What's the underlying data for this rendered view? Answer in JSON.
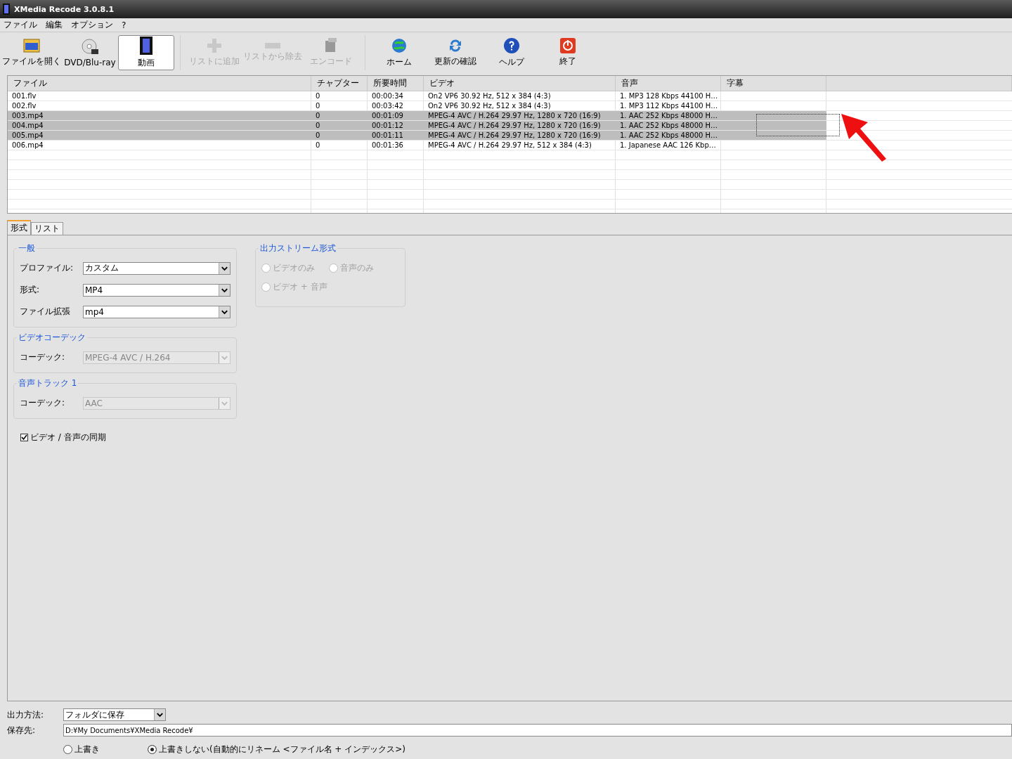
{
  "window": {
    "title": "XMedia Recode 3.0.8.1"
  },
  "menu": [
    "ファイル",
    "編集",
    "オプション",
    "?"
  ],
  "toolbar": {
    "groups": [
      [
        {
          "label": "ファイルを開く",
          "selected": false,
          "disabled": false
        },
        {
          "label": "DVD/Blu-ray",
          "selected": false,
          "disabled": false
        },
        {
          "label": "動画",
          "selected": true,
          "disabled": false
        }
      ],
      [
        {
          "label": "リストに追加",
          "selected": false,
          "disabled": true
        },
        {
          "label": "リストから除去",
          "selected": false,
          "disabled": true
        },
        {
          "label": "エンコード",
          "selected": false,
          "disabled": true
        }
      ],
      [
        {
          "label": "ホーム",
          "selected": false,
          "disabled": false
        },
        {
          "label": "更新の確認",
          "selected": false,
          "disabled": false
        },
        {
          "label": "ヘルプ",
          "selected": false,
          "disabled": false
        },
        {
          "label": "終了",
          "selected": false,
          "disabled": false
        }
      ]
    ]
  },
  "table": {
    "columns": [
      "ファイル",
      "チャプター",
      "所要時間",
      "ビデオ",
      "音声",
      "字幕"
    ],
    "rows": [
      {
        "selected": false,
        "cells": [
          "001.flv",
          "0",
          "00:00:34",
          "On2 VP6 30.92 Hz, 512 x 384 (4:3)",
          "1. MP3 128 Kbps 44100 H…",
          ""
        ]
      },
      {
        "selected": false,
        "cells": [
          "002.flv",
          "0",
          "00:03:42",
          "On2 VP6 30.92 Hz, 512 x 384 (4:3)",
          "1. MP3 112 Kbps 44100 H…",
          ""
        ]
      },
      {
        "selected": true,
        "cells": [
          "003.mp4",
          "0",
          "00:01:09",
          "MPEG-4 AVC / H.264 29.97 Hz, 1280 x 720 (16:9)",
          "1. AAC 252 Kbps 48000 H…",
          ""
        ]
      },
      {
        "selected": true,
        "cells": [
          "004.mp4",
          "0",
          "00:01:12",
          "MPEG-4 AVC / H.264 29.97 Hz, 1280 x 720 (16:9)",
          "1. AAC 252 Kbps 48000 H…",
          ""
        ]
      },
      {
        "selected": true,
        "cells": [
          "005.mp4",
          "0",
          "00:01:11",
          "MPEG-4 AVC / H.264 29.97 Hz, 1280 x 720 (16:9)",
          "1. AAC 252 Kbps 48000 H…",
          ""
        ]
      },
      {
        "selected": false,
        "cells": [
          "006.mp4",
          "0",
          "00:01:36",
          "MPEG-4 AVC / H.264 29.97 Hz, 512 x 384 (4:3)",
          "1. Japanese AAC 126 Kbp…",
          ""
        ]
      }
    ]
  },
  "tabs": [
    {
      "label": "形式",
      "selected": true
    },
    {
      "label": "リスト",
      "selected": false
    }
  ],
  "general": {
    "title": "一般",
    "fields": [
      {
        "label": "プロファイル:",
        "value": "カスタム"
      },
      {
        "label": "形式:",
        "value": "MP4"
      },
      {
        "label": "ファイル拡張",
        "value": "mp4"
      }
    ]
  },
  "video_codec": {
    "title": "ビデオコーデック",
    "label": "コーデック:",
    "value": "MPEG-4 AVC / H.264",
    "disabled": true
  },
  "audio_track": {
    "title": "音声トラック 1",
    "label": "コーデック:",
    "value": "AAC",
    "disabled": true
  },
  "sync": {
    "label": "ビデオ / 音声の同期",
    "checked": true
  },
  "output_stream": {
    "title": "出力ストリーム形式",
    "options": [
      {
        "label": "ビデオのみ",
        "selected": false,
        "disabled": true
      },
      {
        "label": "音声のみ",
        "selected": false,
        "disabled": true
      },
      {
        "label": "ビデオ + 音声",
        "selected": false,
        "disabled": true
      }
    ]
  },
  "output": {
    "method_label": "出力方法:",
    "method": "フォルダに保存",
    "dest_label": "保存先:",
    "dest": "D:¥My Documents¥XMedia Recode¥",
    "overwrite": [
      {
        "label": "上書き",
        "selected": false
      },
      {
        "label": "上書きしない(自動的にリネーム <ファイル名 + インデックス>)",
        "selected": true
      }
    ]
  }
}
